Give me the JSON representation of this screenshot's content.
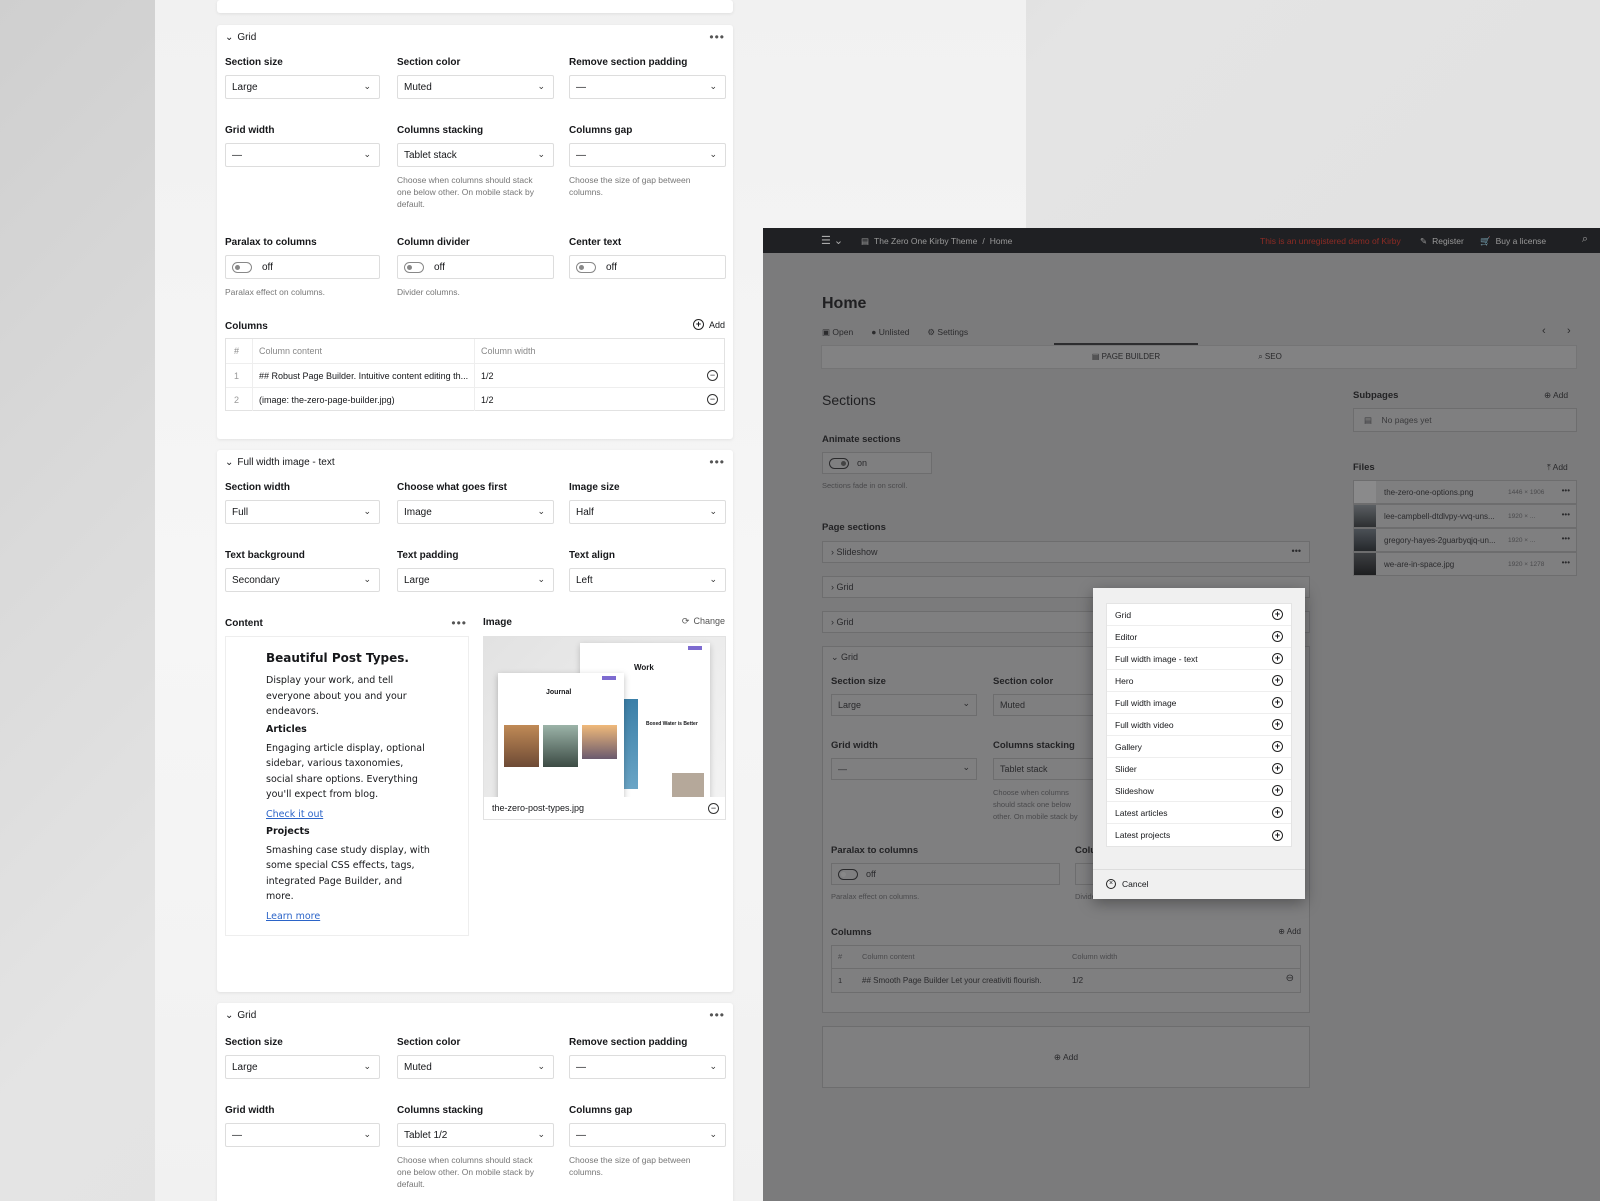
{
  "left": {
    "grid1": {
      "head": "Grid",
      "section_size": {
        "label": "Section size",
        "value": "Large"
      },
      "section_color": {
        "label": "Section color",
        "value": "Muted"
      },
      "remove_padding": {
        "label": "Remove section padding",
        "value": "—"
      },
      "grid_width": {
        "label": "Grid width",
        "value": "—"
      },
      "columns_stacking": {
        "label": "Columns stacking",
        "value": "Tablet stack",
        "help": "Choose when columns should stack one below other. On mobile stack by default."
      },
      "columns_gap": {
        "label": "Columns gap",
        "value": "—",
        "help": "Choose the size of gap between columns."
      },
      "paralax": {
        "label": "Paralax to columns",
        "value": "off",
        "help": "Paralax effect on columns."
      },
      "divider": {
        "label": "Column divider",
        "value": "off",
        "help": "Divider columns."
      },
      "center": {
        "label": "Center text",
        "value": "off"
      },
      "columns_label": "Columns",
      "add": "Add",
      "table_headers": [
        "#",
        "Column content",
        "Column width"
      ],
      "rows": [
        {
          "n": "1",
          "content": "## Robust Page Builder. Intuitive content editing th...",
          "width": "1/2"
        },
        {
          "n": "2",
          "content": "(image: the-zero-page-builder.jpg)",
          "width": "1/2"
        }
      ]
    },
    "fwit": {
      "head": "Full width image - text",
      "section_width": {
        "label": "Section width",
        "value": "Full"
      },
      "goes_first": {
        "label": "Choose what goes first",
        "value": "Image"
      },
      "image_size": {
        "label": "Image size",
        "value": "Half"
      },
      "text_bg": {
        "label": "Text background",
        "value": "Secondary"
      },
      "text_padding": {
        "label": "Text padding",
        "value": "Large"
      },
      "text_align": {
        "label": "Text align",
        "value": "Left"
      },
      "content_label": "Content",
      "image_label": "Image",
      "change": "Change",
      "content": {
        "title": "Beautiful Post Types.",
        "p1": "Display your work, and tell everyone about you and your endeavors.",
        "h_articles": "Articles",
        "p2": "Engaging article display, optional sidebar, various taxonomies, social share options. Everything you'll expect from blog.",
        "link1": "Check it out",
        "h_projects": "Projects",
        "p3": "Smashing case study display, with some special CSS effects, tags, integrated Page Builder, and more.",
        "link2": "Learn more"
      },
      "thumb": {
        "work": "Work",
        "journal": "Journal",
        "water": "Boxed Water is Better"
      },
      "image_file": "the-zero-post-types.jpg"
    },
    "grid2": {
      "head": "Grid",
      "section_size": {
        "label": "Section size",
        "value": "Large"
      },
      "section_color": {
        "label": "Section color",
        "value": "Muted"
      },
      "remove_padding": {
        "label": "Remove section padding",
        "value": "—"
      },
      "grid_width": {
        "label": "Grid width",
        "value": "—"
      },
      "columns_stacking": {
        "label": "Columns stacking",
        "value": "Tablet 1/2",
        "help": "Choose when columns should stack one below other. On mobile stack by default."
      },
      "columns_gap": {
        "label": "Columns gap",
        "value": "—",
        "help": "Choose the size of gap between columns."
      }
    }
  },
  "topbar": {
    "site": "The Zero One Kirby Theme",
    "page": "Home",
    "notice": "This is an unregistered demo of Kirby",
    "register": "Register",
    "buy": "Buy a license"
  },
  "page": {
    "title": "Home",
    "open": "Open",
    "status": "Unlisted",
    "settings": "Settings",
    "tabs": [
      "PAGE BUILDER",
      "SEO"
    ],
    "sections_title": "Sections",
    "animate_label": "Animate sections",
    "animate_value": "on",
    "animate_help": "Sections fade in on scroll.",
    "page_sections": "Page sections",
    "blocks": [
      "Slideshow",
      "Grid",
      "Grid",
      "Grid"
    ],
    "grid": {
      "section_size": "Section size",
      "section_size_value": "Large",
      "section_color": "Section color",
      "section_color_value": "Muted",
      "grid_width": "Grid width",
      "grid_width_value": "—",
      "columns_stacking": "Columns stacking",
      "columns_stacking_value": "Tablet stack",
      "stacking_help": "Choose when columns should stack one below other. On mobile stack by default.",
      "paralax": "Paralax to columns",
      "paralax_value": "off",
      "paralax_help": "Paralax effect on columns.",
      "col_partial": "Colu",
      "divider_help": "Divider columns.",
      "columns": "Columns",
      "add": "Add",
      "headers": [
        "#",
        "Column content",
        "Column width"
      ],
      "row": {
        "n": "1",
        "content": "## Smooth Page Builder Let your creativiti flourish.",
        "width": "1/2"
      }
    },
    "add": "Add",
    "subpages": "Subpages",
    "subpages_add": "Add",
    "no_pages": "No pages yet",
    "files": "Files",
    "files_add": "Add",
    "file_list": [
      {
        "name": "the-zero-one-options.png",
        "size": "1446 × 1906"
      },
      {
        "name": "lee-campbell-dtdlvpy-vvq-uns...",
        "size": "1920 × ..."
      },
      {
        "name": "gregory-hayes-2guarbyqjq-un...",
        "size": "1920 × ..."
      },
      {
        "name": "we-are-in-space.jpg",
        "size": "1920 × 1278"
      }
    ]
  },
  "dialog": {
    "items": [
      "Grid",
      "Editor",
      "Full width image - text",
      "Hero",
      "Full width image",
      "Full width video",
      "Gallery",
      "Slider",
      "Slideshow",
      "Latest articles",
      "Latest projects"
    ],
    "cancel": "Cancel"
  },
  "colors": {
    "accent_link": "#2b64c8",
    "notice": "#c0392b",
    "dark_bar": "#1f2023"
  }
}
